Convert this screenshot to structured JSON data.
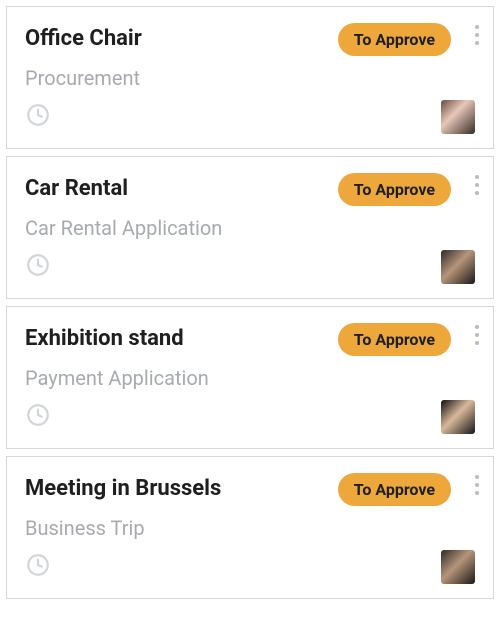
{
  "cards": [
    {
      "title": "Office Chair",
      "subtitle": "Procurement",
      "status": "To Approve",
      "avatar_variant": "a",
      "name_key": "office-chair"
    },
    {
      "title": "Car Rental",
      "subtitle": "Car Rental Application",
      "status": "To Approve",
      "avatar_variant": "b",
      "name_key": "car-rental"
    },
    {
      "title": "Exhibition stand",
      "subtitle": "Payment Application",
      "status": "To Approve",
      "avatar_variant": "c",
      "name_key": "exhibition-stand"
    },
    {
      "title": "Meeting in Brussels",
      "subtitle": "Business Trip",
      "status": "To Approve",
      "avatar_variant": "b",
      "name_key": "meeting-in-brussels"
    }
  ]
}
